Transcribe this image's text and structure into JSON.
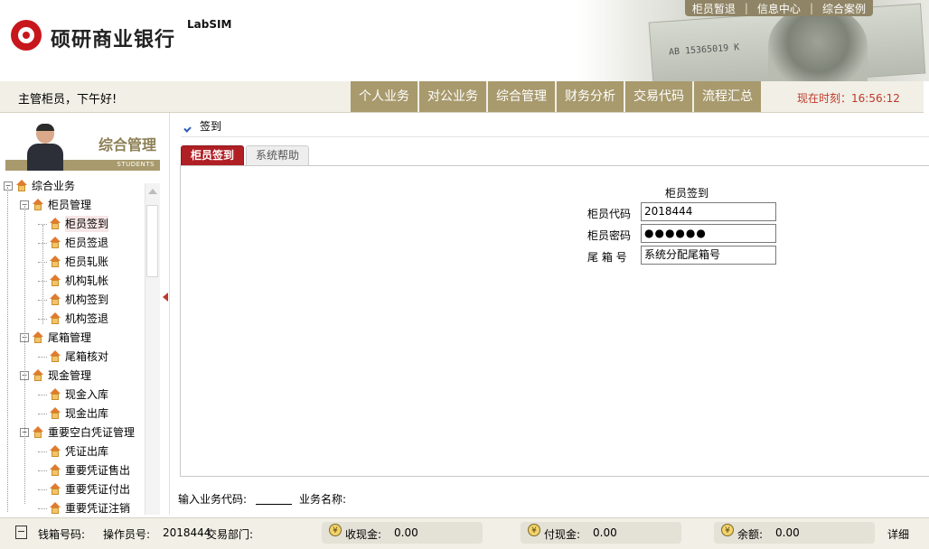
{
  "header": {
    "bank_name": "硕研商业银行",
    "brand": "LabSIM",
    "banknote_serial": "AB 15365019 K",
    "toplinks": [
      "柜员暂退",
      "信息中心",
      "综合案例"
    ]
  },
  "navbar": {
    "greeting": "主管柜员，下午好!",
    "menu": [
      "个人业务",
      "对公业务",
      "综合管理",
      "财务分析",
      "交易代码",
      "流程汇总"
    ],
    "clock_label": "现在时刻：",
    "clock_value": "16:56:12"
  },
  "left": {
    "banner_title": "综合管理",
    "banner_sub": "STUDENTS",
    "tree": [
      {
        "label": "综合业务",
        "level": 0,
        "expander": "−"
      },
      {
        "label": "柜员管理",
        "level": 1,
        "expander": "−"
      },
      {
        "label": "柜员签到",
        "level": 2,
        "active": true
      },
      {
        "label": "柜员签退",
        "level": 2
      },
      {
        "label": "柜员轧账",
        "level": 2
      },
      {
        "label": "机构轧帐",
        "level": 2
      },
      {
        "label": "机构签到",
        "level": 2
      },
      {
        "label": "机构签退",
        "level": 2
      },
      {
        "label": "尾箱管理",
        "level": 1,
        "expander": "−"
      },
      {
        "label": "尾箱核对",
        "level": 2
      },
      {
        "label": "现金管理",
        "level": 1,
        "expander": "−"
      },
      {
        "label": "现金入库",
        "level": 2
      },
      {
        "label": "现金出库",
        "level": 2
      },
      {
        "label": "重要空白凭证管理",
        "level": 1,
        "expander": "−"
      },
      {
        "label": "凭证出库",
        "level": 2
      },
      {
        "label": "重要凭证售出",
        "level": 2
      },
      {
        "label": "重要凭证付出",
        "level": 2
      },
      {
        "label": "重要凭证注销",
        "level": 2
      }
    ]
  },
  "main": {
    "breadcrumb": "签到",
    "tabs": [
      "柜员签到",
      "系统帮助"
    ],
    "form_title": "柜员签到",
    "fields": {
      "teller_code_label": "柜员代码",
      "teller_code_value": "2018444",
      "password_label": "柜员密码",
      "password_value": "●●●●●●",
      "tailbox_label": "尾 箱 号",
      "tailbox_value": "系统分配尾箱号"
    },
    "codebar": {
      "code_label": "输入业务代码:",
      "name_label": "业务名称:"
    }
  },
  "status": {
    "cashbox_label": "钱箱号码:",
    "operator_label": "操作员号:",
    "operator_value": "2018444",
    "dept_label": "交易部门:",
    "receive_label": "收现金:",
    "receive_value": "0.00",
    "pay_label": "付现金:",
    "pay_value": "0.00",
    "balance_label": "余额:",
    "balance_value": "0.00",
    "detail": "详细",
    "yen_symbol": "¥"
  },
  "colors": {
    "brand_red": "#c8161d",
    "menu_gold": "#a89a6d",
    "tab_active": "#b01f24",
    "clock_red": "#c0392b"
  }
}
